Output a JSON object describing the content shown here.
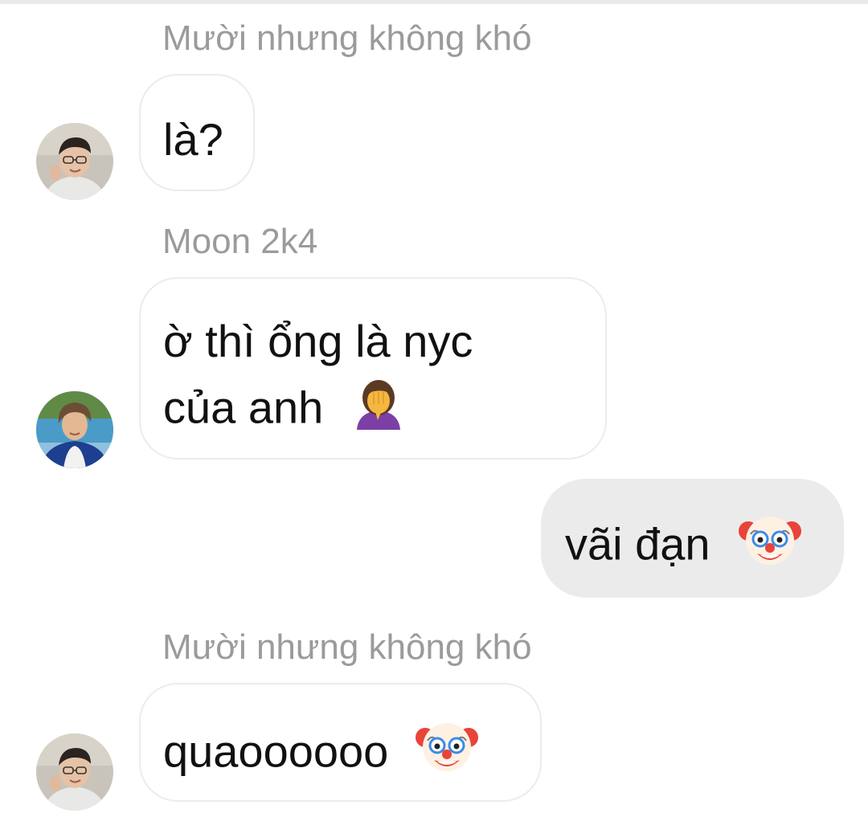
{
  "messages": [
    {
      "sender": "Mười nhưng không khó",
      "text": "là?",
      "direction": "incoming",
      "avatar": "avatar-glasses-guy"
    },
    {
      "sender": "Moon 2k4",
      "lines": [
        "ờ thì ổng là nyc",
        "của anh"
      ],
      "emoji": "woman-facepalming-emoji",
      "direction": "incoming",
      "avatar": "avatar-beach-guy"
    },
    {
      "text": "vãi đạn",
      "emoji": "clown-face-emoji",
      "direction": "outgoing"
    },
    {
      "sender": "Mười nhưng không khó",
      "text": "quaoooooo",
      "emoji": "clown-face-emoji",
      "direction": "incoming",
      "avatar": "avatar-glasses-guy"
    }
  ],
  "colors": {
    "sender_name": "#9b9b9b",
    "incoming_bubble_border": "#ececec",
    "outgoing_bubble_bg": "#ebebeb",
    "text": "#111111"
  }
}
